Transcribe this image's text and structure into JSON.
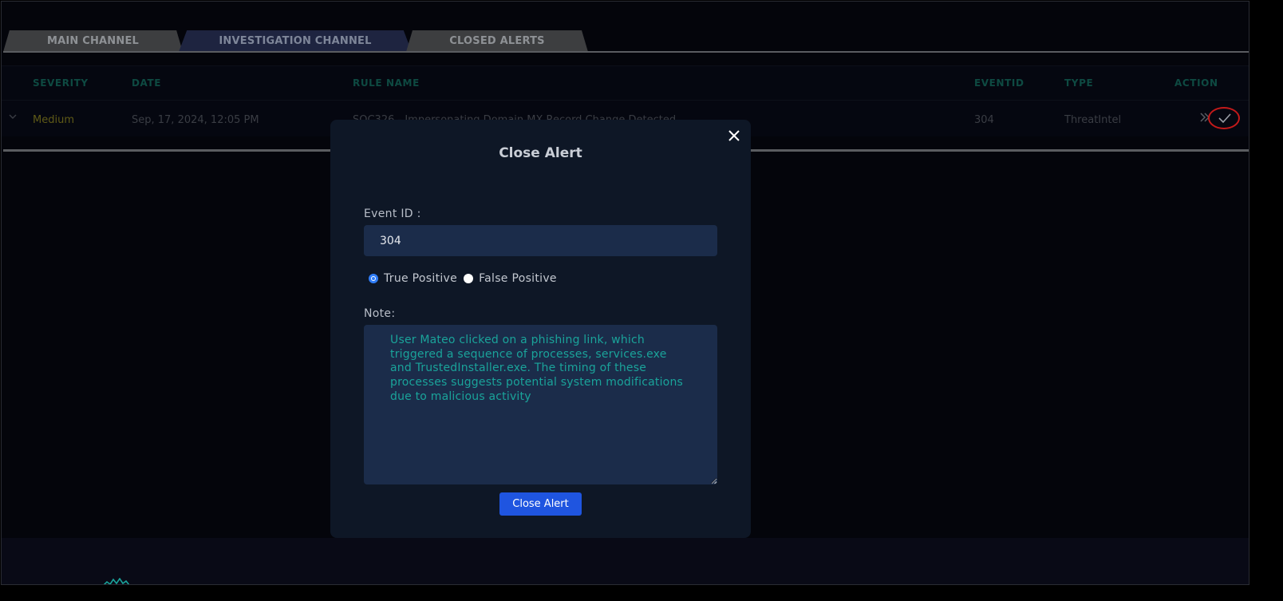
{
  "tabs": [
    {
      "label": "MAIN CHANNEL"
    },
    {
      "label": "INVESTIGATION CHANNEL"
    },
    {
      "label": "CLOSED ALERTS"
    }
  ],
  "table": {
    "headers": [
      "SEVERITY",
      "DATE",
      "RULE NAME",
      "EVENTID",
      "TYPE",
      "ACTION"
    ],
    "rows": [
      {
        "severity": "Medium",
        "date": "Sep, 17, 2024, 12:05 PM",
        "rule_name": "SOC326 - Impersonating Domain MX Record Change Detected",
        "event_id": "304",
        "type": "ThreatIntel"
      }
    ]
  },
  "modal": {
    "title": "Close Alert",
    "event_id_label": "Event ID :",
    "event_id_value": "304",
    "radio_true": "True Positive",
    "radio_false": "False Positive",
    "note_label": "Note:",
    "note_text": "User Mateo clicked on a phishing link, which triggered a sequence of processes, services.exe and TrustedInstaller.exe. The timing of these processes suggests potential system modifications due to malicious activity",
    "button_label": "Close Alert"
  },
  "colors": {
    "modal_bg": "#0e1726",
    "field_bg": "#1b2c4a",
    "accent_blue": "#1f55e0",
    "note_text": "#1aa39a",
    "highlight_ring": "#c41a1a"
  },
  "icons": {
    "row_expand": "chevron-down-icon",
    "action_forward": "double-chevron-right-icon",
    "action_close": "checkmark-icon",
    "modal_close": "close-icon"
  }
}
